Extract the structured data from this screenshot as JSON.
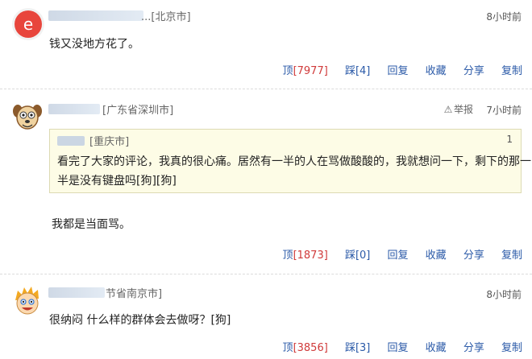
{
  "comments": [
    {
      "location": "...[北京市]",
      "time": "8小时前",
      "text": "钱又没地方花了。",
      "actions": {
        "up_label": "顶",
        "up_count": "[7977]",
        "down_label": "踩",
        "down_count": "[4]",
        "reply": "回复",
        "collect": "收藏",
        "share": "分享",
        "copy": "复制"
      }
    },
    {
      "location": "[广东省深圳市]",
      "report": "举报",
      "time": "7小时前",
      "quote": {
        "location": "[重庆市]",
        "floor": "1",
        "line1": "看完了大家的评论，我真的很心痛。居然有一半的人在骂做酸酸的，我就想问一下，剩下的那一",
        "line2": "半是没有键盘吗[狗][狗]"
      },
      "text": "我都是当面骂。",
      "actions": {
        "up_label": "顶",
        "up_count": "[1873]",
        "down_label": "踩",
        "down_count": "[0]",
        "reply": "回复",
        "collect": "收藏",
        "share": "分享",
        "copy": "复制"
      }
    },
    {
      "location": "节省南京市]",
      "time": "8小时前",
      "text": "很纳闷 什么样的群体会去做呀？[狗]",
      "actions": {
        "up_label": "顶",
        "up_count": "[3856]",
        "down_label": "踩",
        "down_count": "[3]",
        "reply": "回复",
        "collect": "收藏",
        "share": "分享",
        "copy": "复制"
      }
    }
  ],
  "colors": {
    "link": "#2b5aa8",
    "count": "#d03a3a",
    "quote_bg": "#fdfce6"
  },
  "icons": [
    "red-e-avatar-icon",
    "cartoon-dog-avatar-icon",
    "boy-avatar-icon",
    "warning-triangle-icon"
  ]
}
